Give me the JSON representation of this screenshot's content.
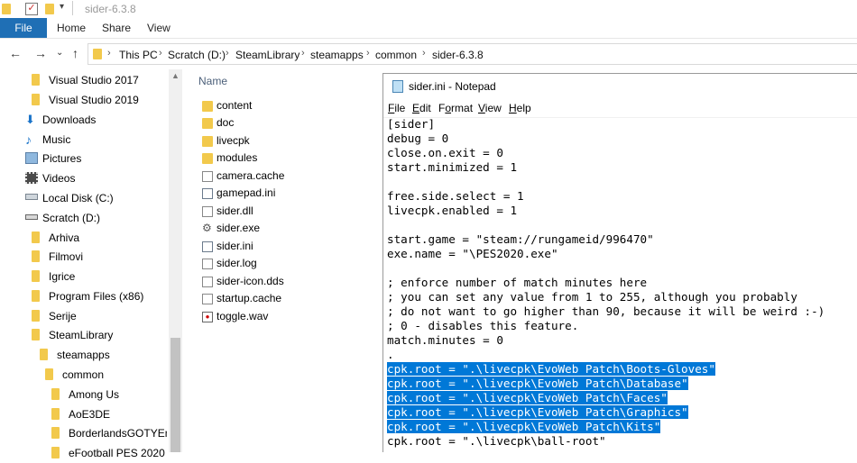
{
  "window": {
    "title": "sider-6.3.8"
  },
  "ribbon": {
    "tabs": [
      "File",
      "Home",
      "Share",
      "View"
    ]
  },
  "address": {
    "crumbs": [
      "This PC",
      "Scratch (D:)",
      "SteamLibrary",
      "steamapps",
      "common",
      "sider-6.3.8"
    ]
  },
  "sidebar": {
    "items": [
      {
        "label": "Visual Studio 2017",
        "icon": "folder-icon"
      },
      {
        "label": "Visual Studio 2019",
        "icon": "folder-icon"
      },
      {
        "label": "Downloads",
        "icon": "downloads-icon"
      },
      {
        "label": "Music",
        "icon": "music-icon"
      },
      {
        "label": "Pictures",
        "icon": "pictures-icon"
      },
      {
        "label": "Videos",
        "icon": "videos-icon"
      },
      {
        "label": "Local Disk (C:)",
        "icon": "drive-icon"
      },
      {
        "label": "Scratch (D:)",
        "icon": "drive-icon"
      },
      {
        "label": "Arhiva",
        "icon": "folder-icon"
      },
      {
        "label": "Filmovi",
        "icon": "folder-icon"
      },
      {
        "label": "Igrice",
        "icon": "folder-icon"
      },
      {
        "label": "Program Files (x86)",
        "icon": "folder-icon"
      },
      {
        "label": "Serije",
        "icon": "folder-icon"
      },
      {
        "label": "SteamLibrary",
        "icon": "folder-icon"
      },
      {
        "label": "steamapps",
        "icon": "folder-icon"
      },
      {
        "label": "common",
        "icon": "folder-icon"
      },
      {
        "label": "Among Us",
        "icon": "folder-icon"
      },
      {
        "label": "AoE3DE",
        "icon": "folder-icon"
      },
      {
        "label": "BorderlandsGOTYEnhar",
        "icon": "folder-icon"
      },
      {
        "label": "eFootball PES 2020",
        "icon": "folder-icon"
      }
    ]
  },
  "content": {
    "column_name": "Name",
    "files": [
      {
        "label": "content",
        "icon": "folder-icon"
      },
      {
        "label": "doc",
        "icon": "folder-icon"
      },
      {
        "label": "livecpk",
        "icon": "folder-icon"
      },
      {
        "label": "modules",
        "icon": "folder-icon"
      },
      {
        "label": "camera.cache",
        "icon": "file-icon"
      },
      {
        "label": "gamepad.ini",
        "icon": "settings-file-icon"
      },
      {
        "label": "sider.dll",
        "icon": "dll-file-icon"
      },
      {
        "label": "sider.exe",
        "icon": "exe-file-icon"
      },
      {
        "label": "sider.ini",
        "icon": "settings-file-icon"
      },
      {
        "label": "sider.log",
        "icon": "file-icon"
      },
      {
        "label": "sider-icon.dds",
        "icon": "file-icon"
      },
      {
        "label": "startup.cache",
        "icon": "file-icon"
      },
      {
        "label": "toggle.wav",
        "icon": "audio-file-icon"
      }
    ]
  },
  "notepad": {
    "title": "sider.ini - Notepad",
    "menus": [
      {
        "label": "File",
        "accel": "F",
        "rest": "ile"
      },
      {
        "label": "Edit",
        "accel": "E",
        "rest": "dit"
      },
      {
        "label": "Format",
        "accel": "o",
        "pre": "F",
        "rest": "rmat"
      },
      {
        "label": "View",
        "accel": "V",
        "rest": "iew"
      },
      {
        "label": "Help",
        "accel": "H",
        "rest": "elp"
      }
    ],
    "lines": [
      {
        "text": "[sider]",
        "selected": false
      },
      {
        "text": "debug = 0",
        "selected": false
      },
      {
        "text": "close.on.exit = 0",
        "selected": false
      },
      {
        "text": "start.minimized = 1",
        "selected": false
      },
      {
        "text": "",
        "selected": false
      },
      {
        "text": "free.side.select = 1",
        "selected": false
      },
      {
        "text": "livecpk.enabled = 1",
        "selected": false
      },
      {
        "text": "",
        "selected": false
      },
      {
        "text": "start.game = \"steam://rungameid/996470\"",
        "selected": false
      },
      {
        "text": "exe.name = \"\\PES2020.exe\"",
        "selected": false
      },
      {
        "text": "",
        "selected": false
      },
      {
        "text": "; enforce number of match minutes here",
        "selected": false
      },
      {
        "text": "; you can set any value from 1 to 255, although you probably",
        "selected": false
      },
      {
        "text": "; do not want to go higher than 90, because it will be weird :-)",
        "selected": false
      },
      {
        "text": "; 0 - disables this feature.",
        "selected": false
      },
      {
        "text": "match.minutes = 0",
        "selected": false
      },
      {
        "text": ".",
        "selected": false
      },
      {
        "text": "cpk.root = \".\\livecpk\\EvoWeb Patch\\Boots-Gloves\"",
        "selected": true
      },
      {
        "text": "cpk.root = \".\\livecpk\\EvoWeb Patch\\Database\"",
        "selected": true
      },
      {
        "text": "cpk.root = \".\\livecpk\\EvoWeb Patch\\Faces\"",
        "selected": true
      },
      {
        "text": "cpk.root = \".\\livecpk\\EvoWeb Patch\\Graphics\"",
        "selected": true
      },
      {
        "text": "cpk.root = \".\\livecpk\\EvoWeb Patch\\Kits\"",
        "selected": true
      },
      {
        "text": "cpk.root = \".\\livecpk\\ball-root\"",
        "selected": false
      }
    ]
  }
}
